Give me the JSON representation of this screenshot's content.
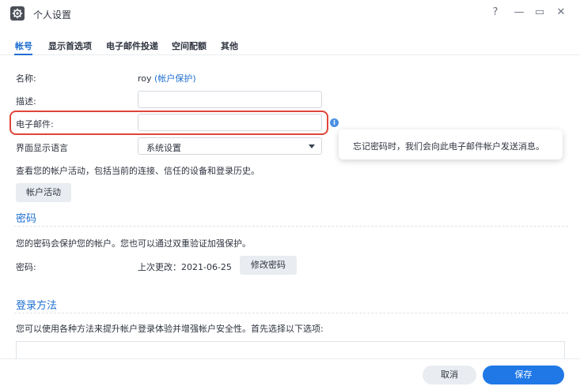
{
  "window": {
    "title": "个人设置",
    "help": "?",
    "minimize": "—",
    "maximize": "▭",
    "close": "✕"
  },
  "tabs": [
    {
      "label": "帐号",
      "active": true
    },
    {
      "label": "显示首选项",
      "active": false
    },
    {
      "label": "电子邮件投递",
      "active": false
    },
    {
      "label": "空间配额",
      "active": false
    },
    {
      "label": "其他",
      "active": false
    }
  ],
  "form": {
    "name_label": "名称:",
    "name_value": "roy",
    "name_link": "(帐户保护)",
    "description_label": "描述:",
    "description_value": "",
    "email_label": "电子邮件:",
    "email_value": "",
    "language_label": "界面显示语言",
    "language_value": "系统设置"
  },
  "tooltip": {
    "text": "忘记密码时，我们会向此电子邮件帐户发送消息。"
  },
  "activity": {
    "description": "查看您的帐户活动，包括当前的连接、信任的设备和登录历史。",
    "button": "帐户活动"
  },
  "password": {
    "section_title": "密码",
    "description": "您的密码会保护您的帐户。您也可以通过双重验证加强保护。",
    "label": "密码:",
    "last_changed": "上次更改：2021-06-25",
    "change_button": "修改密码"
  },
  "login": {
    "section_title": "登录方法",
    "description": "您可以使用各种方法来提升帐户登录体验并增强帐户安全性。首先选择以下选项:"
  },
  "footer": {
    "cancel": "取消",
    "save": "保存"
  },
  "colors": {
    "accent": "#1f6fd1",
    "highlight": "#e0453a",
    "save_button": "#1f78e6"
  }
}
